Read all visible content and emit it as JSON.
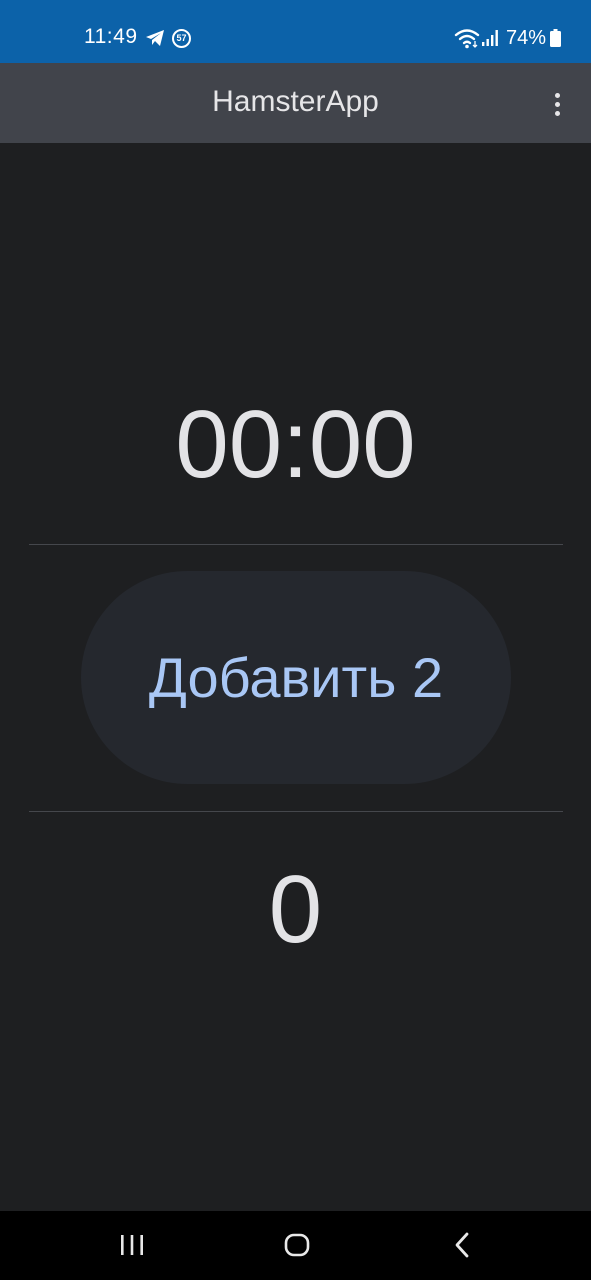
{
  "status_bar": {
    "time": "11:49",
    "notification_badge": "57",
    "battery_percent": "74%",
    "icons": [
      "telegram-icon",
      "notification-count-icon",
      "wifi-icon",
      "signal-icon",
      "battery-icon"
    ],
    "background_color": "#0c62a9"
  },
  "app_bar": {
    "title": "HamsterApp",
    "menu_icon": "more-vert-icon",
    "background_color": "#41444b"
  },
  "main": {
    "timer": "00:00",
    "add_button_label": "Добавить 2",
    "counter": "0",
    "accent_color": "#a9c7f5"
  },
  "nav_bar": {
    "icons": [
      "recents-icon",
      "home-icon",
      "back-icon"
    ]
  }
}
